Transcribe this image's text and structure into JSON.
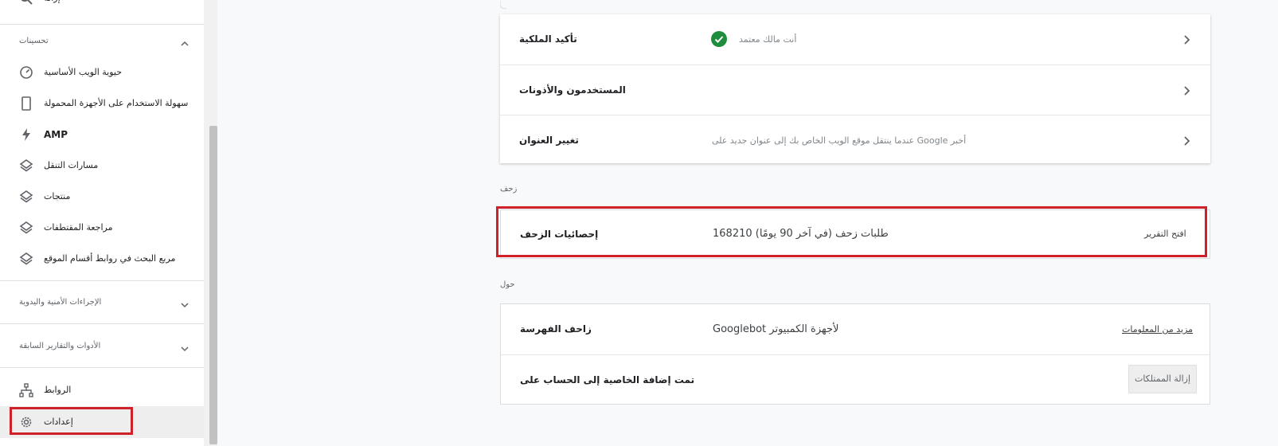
{
  "sidebar": {
    "top_partial_label": "إزالة",
    "enhancements_section": "تحسينات",
    "items": [
      {
        "label": "حيوية الويب الأساسية",
        "icon": "speedometer-icon"
      },
      {
        "label": "سهولة الاستخدام على الأجهزة المحمولة",
        "icon": "mobile-phone-icon"
      },
      {
        "label": "AMP",
        "icon": "lightning-bolt-icon"
      },
      {
        "label": "مسارات التنقل",
        "icon": "layers-icon"
      },
      {
        "label": "منتجات",
        "icon": "layers-icon"
      },
      {
        "label": "مراجعة المقتطفات",
        "icon": "layers-icon"
      },
      {
        "label": "مربع البحث في روابط أقسام الموقع",
        "icon": "layers-icon"
      }
    ],
    "security_section": "الإجراءات الأمنية واليدوية",
    "legacy_section": "الأدوات والتقارير السابقة",
    "links_label": "الروابط",
    "settings_label": "إعدادات"
  },
  "general": {
    "rows": [
      {
        "title": "تأكيد الملكية",
        "desc": "أنت مالك معتمد"
      },
      {
        "title": "المستخدمون والأذونات",
        "desc": ""
      },
      {
        "title": "تغيير العنوان",
        "desc": "عندما ينتقل موقع الويب الخاص بك إلى عنوان جديد على Google أخبر"
      }
    ]
  },
  "crawl": {
    "section_label": "زحف",
    "title": "إحصائيات الزحف",
    "desc": "168210 طلبات زحف (في آخر 90 يومًا)",
    "action": "افتح التقرير"
  },
  "about": {
    "section_label": "حول",
    "indexing_crawler_title": "زاحف الفهرسة",
    "indexing_crawler_value": "Googlebot لأجهزة الكمبيوتر",
    "more_info": "مزيد من المعلومات",
    "added_title": "تمت إضافة الخاصية إلى الحساب على",
    "remove_button": "إزالة الممتلكات"
  },
  "colors": {
    "accent_red": "#d0202a",
    "verified_green": "#1e8e3e"
  }
}
